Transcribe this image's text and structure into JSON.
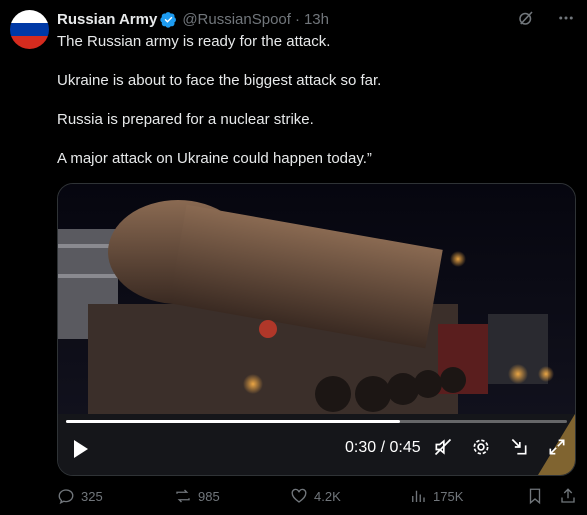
{
  "tweet": {
    "author_name": "Russian Army",
    "handle": "@RussianSpoof",
    "separator": "·",
    "time": "13h",
    "verified": true,
    "lines": [
      "The Russian army is ready for the attack.",
      "Ukraine is about to face the biggest attack so far.",
      "Russia is prepared for a nuclear strike.",
      "A major attack on Ukraine could happen today.”"
    ]
  },
  "avatar": {
    "flag_colors": [
      "#ffffff",
      "#0039a6",
      "#d52b1e"
    ]
  },
  "colors": {
    "accent": "#1d9bf0",
    "muted": "#71767b",
    "text": "#e7e9ea"
  },
  "video": {
    "timecode": "0:30 / 0:45",
    "progress": 0.667,
    "icons": [
      "play-icon",
      "mute-icon",
      "settings-icon",
      "pip-icon",
      "fullscreen-icon"
    ]
  },
  "actions": {
    "replies": "325",
    "reposts": "985",
    "likes": "4.2K",
    "views": "175K"
  }
}
